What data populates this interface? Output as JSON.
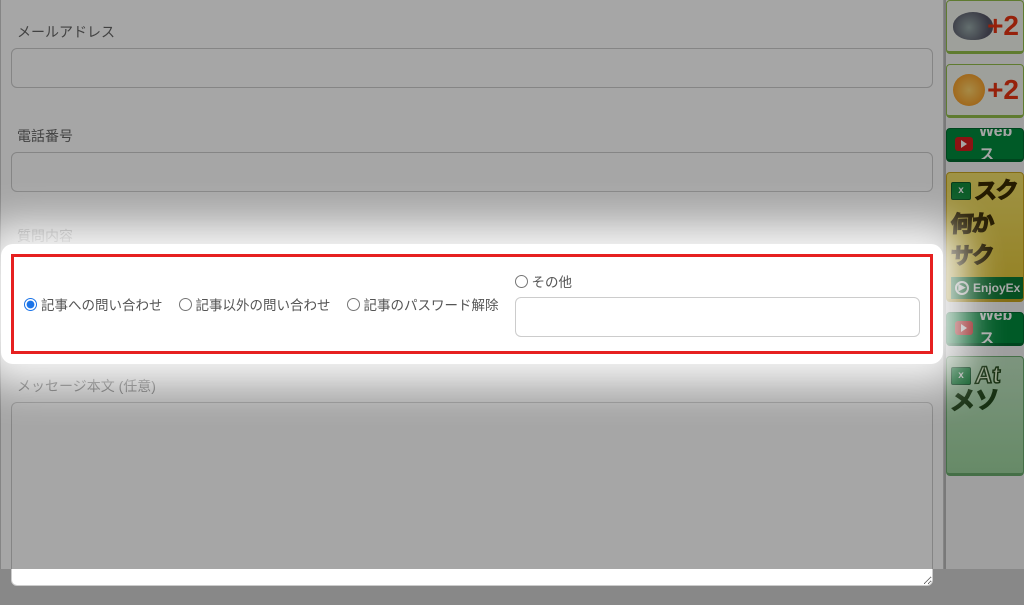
{
  "form": {
    "email_label": "メールアドレス",
    "phone_label": "電話番号",
    "question_type_label": "質問内容",
    "message_label": "メッセージ本文 (任意)",
    "radios": {
      "article": "記事への問い合わせ",
      "non_article": "記事以外の問い合わせ",
      "password": "記事のパスワード解除",
      "other": "その他"
    },
    "selected": "article",
    "email_value": "",
    "phone_value": "",
    "other_value": "",
    "message_value": ""
  },
  "sidebar": {
    "wx1_temp": "+2",
    "wx2_temp": "+2",
    "green_banner": "Webス",
    "ad1_line1": "スク",
    "ad1_line2": "何か",
    "ad1_line3": "サク",
    "ad1_foot": "EnjoyEx",
    "green_banner2": "Webス",
    "ad2_line1": "At",
    "ad2_line2": "メソ"
  }
}
